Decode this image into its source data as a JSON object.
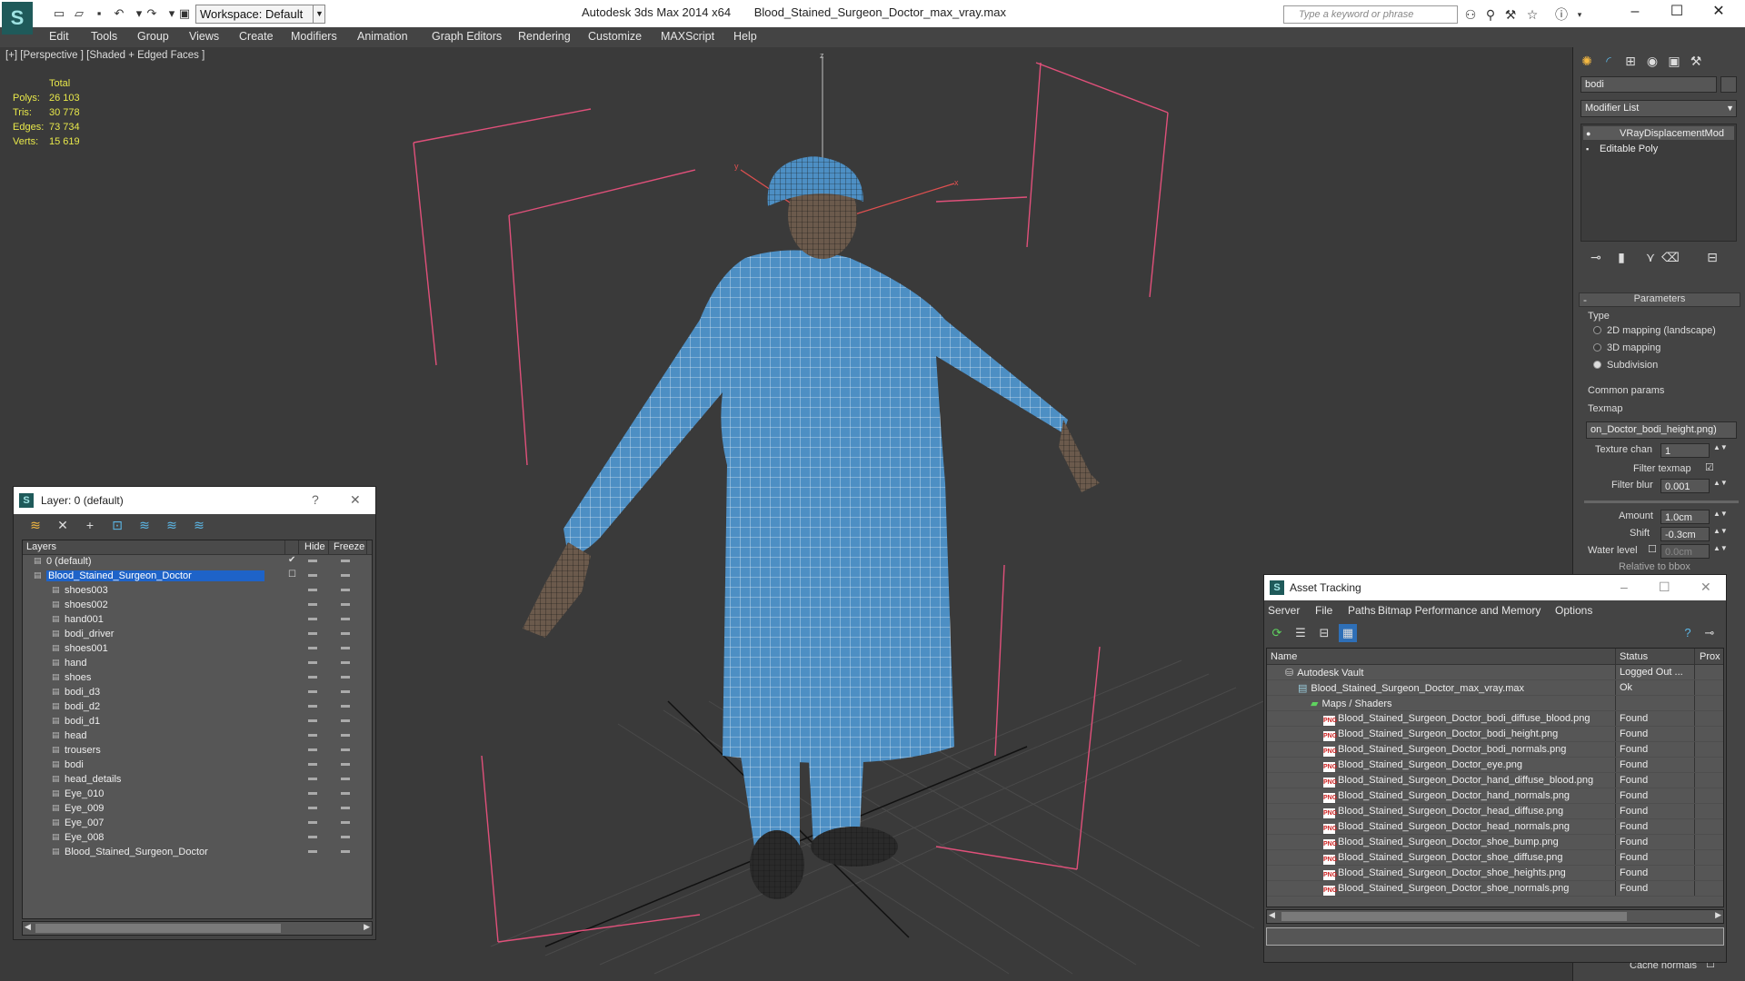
{
  "titlebar": {
    "app_title": "Autodesk 3ds Max 2014 x64",
    "file_title": "Blood_Stained_Surgeon_Doctor_max_vray.max",
    "workspace": "Workspace: Default",
    "search_placeholder": "Type a keyword or phrase"
  },
  "menu": [
    "Edit",
    "Tools",
    "Group",
    "Views",
    "Create",
    "Modifiers",
    "Animation",
    "Graph Editors",
    "Rendering",
    "Customize",
    "MAXScript",
    "Help"
  ],
  "viewport": {
    "label": "[+] [Perspective ] [Shaded + Edged Faces ]",
    "stats_header": "Total",
    "stats": [
      {
        "key": "Polys:",
        "value": "26 103"
      },
      {
        "key": "Tris:",
        "value": "30 778"
      },
      {
        "key": "Edges:",
        "value": "73 734"
      },
      {
        "key": "Verts:",
        "value": "15 619"
      }
    ],
    "axis_labels": {
      "z": "z",
      "y": "y",
      "x": "x"
    }
  },
  "command_panel": {
    "object_name": "bodi",
    "modifier_list": "Modifier List",
    "stack": [
      "VRayDisplacementMod",
      "Editable Poly"
    ],
    "rollout_title": "Parameters",
    "type_label": "Type",
    "type_options": [
      "2D mapping (landscape)",
      "3D mapping",
      "Subdivision"
    ],
    "common_label": "Common params",
    "texmap_label": "Texmap",
    "texmap_value": "on_Doctor_bodi_height.png)",
    "texture_chan_label": "Texture chan",
    "texture_chan_value": "1",
    "filter_texmap_label": "Filter texmap",
    "filter_blur_label": "Filter blur",
    "filter_blur_value": "0.001",
    "amount_label": "Amount",
    "amount_value": "1.0cm",
    "shift_label": "Shift",
    "shift_value": "-0.3cm",
    "water_label": "Water level",
    "water_value": "0.0cm",
    "relative_label": "Relative to bbox",
    "cache_normals": "Cache normals"
  },
  "layer_panel": {
    "title": "Layer: 0 (default)",
    "help": "?",
    "columns": {
      "layers": "Layers",
      "hide": "Hide",
      "freeze": "Freeze"
    },
    "rows": [
      {
        "name": "0 (default)",
        "level": 1
      },
      {
        "name": "Blood_Stained_Surgeon_Doctor",
        "level": 1,
        "selected": true
      },
      {
        "name": "shoes003",
        "level": 2
      },
      {
        "name": "shoes002",
        "level": 2
      },
      {
        "name": "hand001",
        "level": 2
      },
      {
        "name": "bodi_driver",
        "level": 2
      },
      {
        "name": "shoes001",
        "level": 2
      },
      {
        "name": "hand",
        "level": 2
      },
      {
        "name": "shoes",
        "level": 2
      },
      {
        "name": "bodi_d3",
        "level": 2
      },
      {
        "name": "bodi_d2",
        "level": 2
      },
      {
        "name": "bodi_d1",
        "level": 2
      },
      {
        "name": "head",
        "level": 2
      },
      {
        "name": "trousers",
        "level": 2
      },
      {
        "name": "bodi",
        "level": 2
      },
      {
        "name": "head_details",
        "level": 2
      },
      {
        "name": "Eye_010",
        "level": 2
      },
      {
        "name": "Eye_009",
        "level": 2
      },
      {
        "name": "Eye_007",
        "level": 2
      },
      {
        "name": "Eye_008",
        "level": 2
      },
      {
        "name": "Blood_Stained_Surgeon_Doctor",
        "level": 2
      }
    ]
  },
  "asset_tracking": {
    "title": "Asset Tracking",
    "menu": [
      "Server",
      "File",
      "Paths",
      "Bitmap Performance and Memory",
      "Options"
    ],
    "columns": {
      "name": "Name",
      "status": "Status",
      "prox": "Prox"
    },
    "rows": [
      {
        "name": "Autodesk Vault",
        "status": "Logged Out ...",
        "level": 0,
        "icon": "vault"
      },
      {
        "name": "Blood_Stained_Surgeon_Doctor_max_vray.max",
        "status": "Ok",
        "level": 1,
        "icon": "max"
      },
      {
        "name": "Maps / Shaders",
        "status": "",
        "level": 2,
        "icon": "maps"
      },
      {
        "name": "Blood_Stained_Surgeon_Doctor_bodi_diffuse_blood.png",
        "status": "Found",
        "level": 3,
        "icon": "png"
      },
      {
        "name": "Blood_Stained_Surgeon_Doctor_bodi_height.png",
        "status": "Found",
        "level": 3,
        "icon": "png"
      },
      {
        "name": "Blood_Stained_Surgeon_Doctor_bodi_normals.png",
        "status": "Found",
        "level": 3,
        "icon": "png"
      },
      {
        "name": "Blood_Stained_Surgeon_Doctor_eye.png",
        "status": "Found",
        "level": 3,
        "icon": "png"
      },
      {
        "name": "Blood_Stained_Surgeon_Doctor_hand_diffuse_blood.png",
        "status": "Found",
        "level": 3,
        "icon": "png"
      },
      {
        "name": "Blood_Stained_Surgeon_Doctor_hand_normals.png",
        "status": "Found",
        "level": 3,
        "icon": "png"
      },
      {
        "name": "Blood_Stained_Surgeon_Doctor_head_diffuse.png",
        "status": "Found",
        "level": 3,
        "icon": "png"
      },
      {
        "name": "Blood_Stained_Surgeon_Doctor_head_normals.png",
        "status": "Found",
        "level": 3,
        "icon": "png"
      },
      {
        "name": "Blood_Stained_Surgeon_Doctor_shoe_bump.png",
        "status": "Found",
        "level": 3,
        "icon": "png"
      },
      {
        "name": "Blood_Stained_Surgeon_Doctor_shoe_diffuse.png",
        "status": "Found",
        "level": 3,
        "icon": "png"
      },
      {
        "name": "Blood_Stained_Surgeon_Doctor_shoe_heights.png",
        "status": "Found",
        "level": 3,
        "icon": "png"
      },
      {
        "name": "Blood_Stained_Surgeon_Doctor_shoe_normals.png",
        "status": "Found",
        "level": 3,
        "icon": "png"
      }
    ]
  },
  "colors": {
    "accent_selection": "#1e63c8",
    "stats_text": "#e8e84a",
    "scrub_blue": "#4d8fc4",
    "bbox_pink": "#e0507a"
  }
}
